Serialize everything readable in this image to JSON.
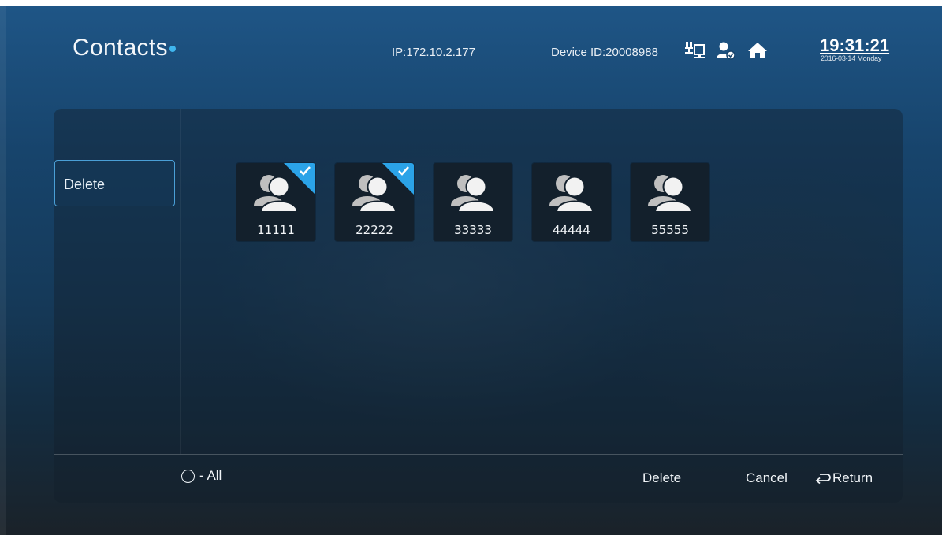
{
  "header": {
    "title": "Contacts",
    "ip": "IP:172.10.2.177",
    "device_id": "Device ID:20008988",
    "time": "19:31:21",
    "date": "2016-03-14 Monday",
    "status_icons": [
      "network-icon",
      "user-status-icon",
      "home-icon"
    ]
  },
  "sidebar": {
    "items": [
      {
        "label": "Delete",
        "selected": true
      }
    ]
  },
  "contacts": [
    {
      "number": "11111",
      "checked": true
    },
    {
      "number": "22222",
      "checked": true
    },
    {
      "number": "33333",
      "checked": false
    },
    {
      "number": "44444",
      "checked": false
    },
    {
      "number": "55555",
      "checked": false
    }
  ],
  "footer": {
    "select_all_label": "- All",
    "delete_label": "Delete",
    "cancel_label": "Cancel",
    "return_label": "Return"
  },
  "colors": {
    "accent": "#2ba3e8",
    "title_dot": "#3fb6ee"
  }
}
